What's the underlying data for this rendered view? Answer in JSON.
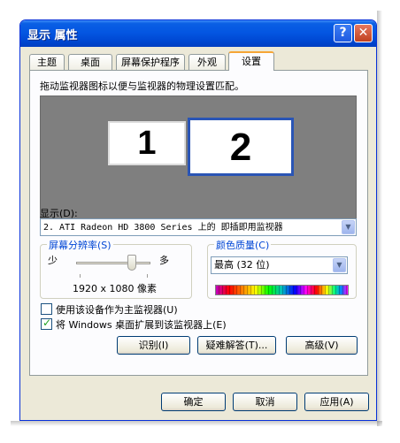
{
  "window": {
    "title": "显示 属性",
    "help_btn": "?",
    "close_btn": "✕"
  },
  "tabs": [
    {
      "label": "主题"
    },
    {
      "label": "桌面"
    },
    {
      "label": "屏幕保护程序"
    },
    {
      "label": "外观"
    },
    {
      "label": "设置"
    }
  ],
  "settings": {
    "instruction": "拖动监视器图标以便与监视器的物理设置匹配。",
    "monitors": [
      {
        "label": "1"
      },
      {
        "label": "2"
      }
    ],
    "display_label": "显示(D):",
    "display_value": "2. ATI Radeon HD 3800 Series  上的 即插即用监视器",
    "resolution": {
      "group_label": "屏幕分辨率(S)",
      "less": "少",
      "more": "多",
      "value": "1920 x 1080 像素",
      "slider_position": 0.75
    },
    "color_quality": {
      "group_label": "颜色质量(C)",
      "value": "最高 (32 位)"
    },
    "primary_checkbox": {
      "label": "使用该设备作为主监视器(U)",
      "checked": false
    },
    "extend_checkbox": {
      "label": "将 Windows 桌面扩展到该监视器上(E)",
      "checked": true
    },
    "buttons": {
      "identify": "识别(I)",
      "troubleshoot": "疑难解答(T)...",
      "advanced": "高级(V)"
    }
  },
  "footer": {
    "ok": "确定",
    "cancel": "取消",
    "apply": "应用(A)"
  },
  "colors": {
    "title_bar": "#0456e2",
    "dialog_bg": "#ece9d8",
    "group_label": "#0046d5"
  }
}
